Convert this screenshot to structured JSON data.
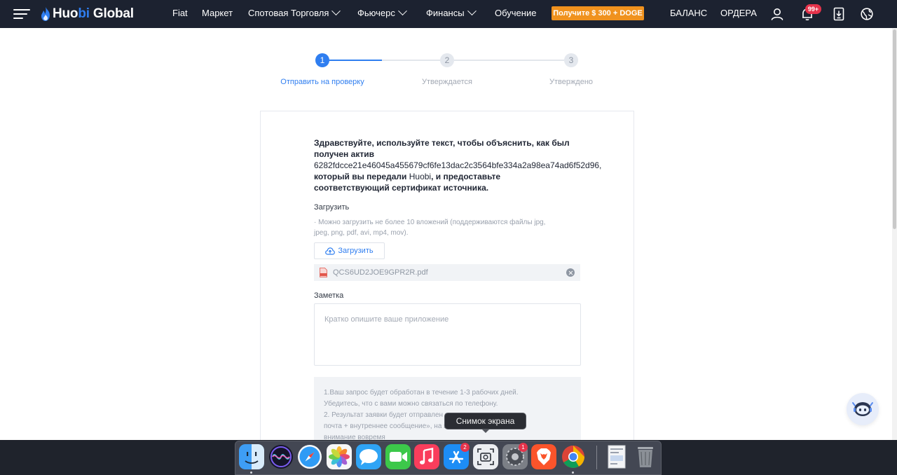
{
  "brand": {
    "logo_part1": "Huo",
    "logo_part2": "bi",
    "logo_part3": " Global"
  },
  "nav": {
    "fiat": "Fiat",
    "market": "Маркет",
    "spot": "Спотовая Торговля",
    "futures": "Фьючерс",
    "finance": "Финансы",
    "learning": "Обучение",
    "promo": "Получите $ 300 + DOGE",
    "balance": "БАЛАНС",
    "orders": "ОРДЕРА",
    "notifications_badge": "99+"
  },
  "stepper": {
    "steps": [
      {
        "number": "1",
        "label": "Отправить на проверку",
        "state": "active"
      },
      {
        "number": "2",
        "label": "Утверждается",
        "state": "pending"
      },
      {
        "number": "3",
        "label": "Утверждено",
        "state": "pending"
      }
    ]
  },
  "form": {
    "intro_line1": "Здравствуйте, используйте текст, чтобы объяснить, как был",
    "intro_line2": "получен актив",
    "intro_hash": "6282fdcce21e46045a455679cf6fe13dac2c3564bfe334a2a98ea74ad6f52d96,",
    "intro_line4a": "который вы передали ",
    "intro_brand": "Huobi",
    "intro_line4b": ", и предоставьте",
    "intro_line5": "соответствующий сертификат источника.",
    "upload_label": "Загрузить",
    "upload_hint_line1": "· Можно загрузить не более 10 вложений (поддерживаются файлы jpg,",
    "upload_hint_line2": "jpeg, png, pdf, avi, mp4, mov).",
    "upload_button": "Загрузить",
    "uploaded_file": "QCS6UD2JOE9GPR2R.pdf",
    "note_label": "Заметка",
    "note_placeholder": "Кратко опишите ваше приложение",
    "info_line1": "1.Ваш запрос будет обработан в течение 1-3 рабочих дней.",
    "info_line2": "Убедитесь, что с вами можно связаться по телефону.",
    "info_line3": "2. Результат заявки будет отправлен             электронная",
    "info_line4": "почта + внутреннее сообщение»,            на это",
    "info_line5": "внимание вовремя"
  },
  "dock": {
    "tooltip": "Снимок экрана",
    "appstore_badge": "2",
    "settings_badge": "1"
  },
  "colors": {
    "accent": "#2f7ef0",
    "nav_bg": "#1c2230",
    "promo": "#f0921e",
    "badge": "#e5334b"
  }
}
